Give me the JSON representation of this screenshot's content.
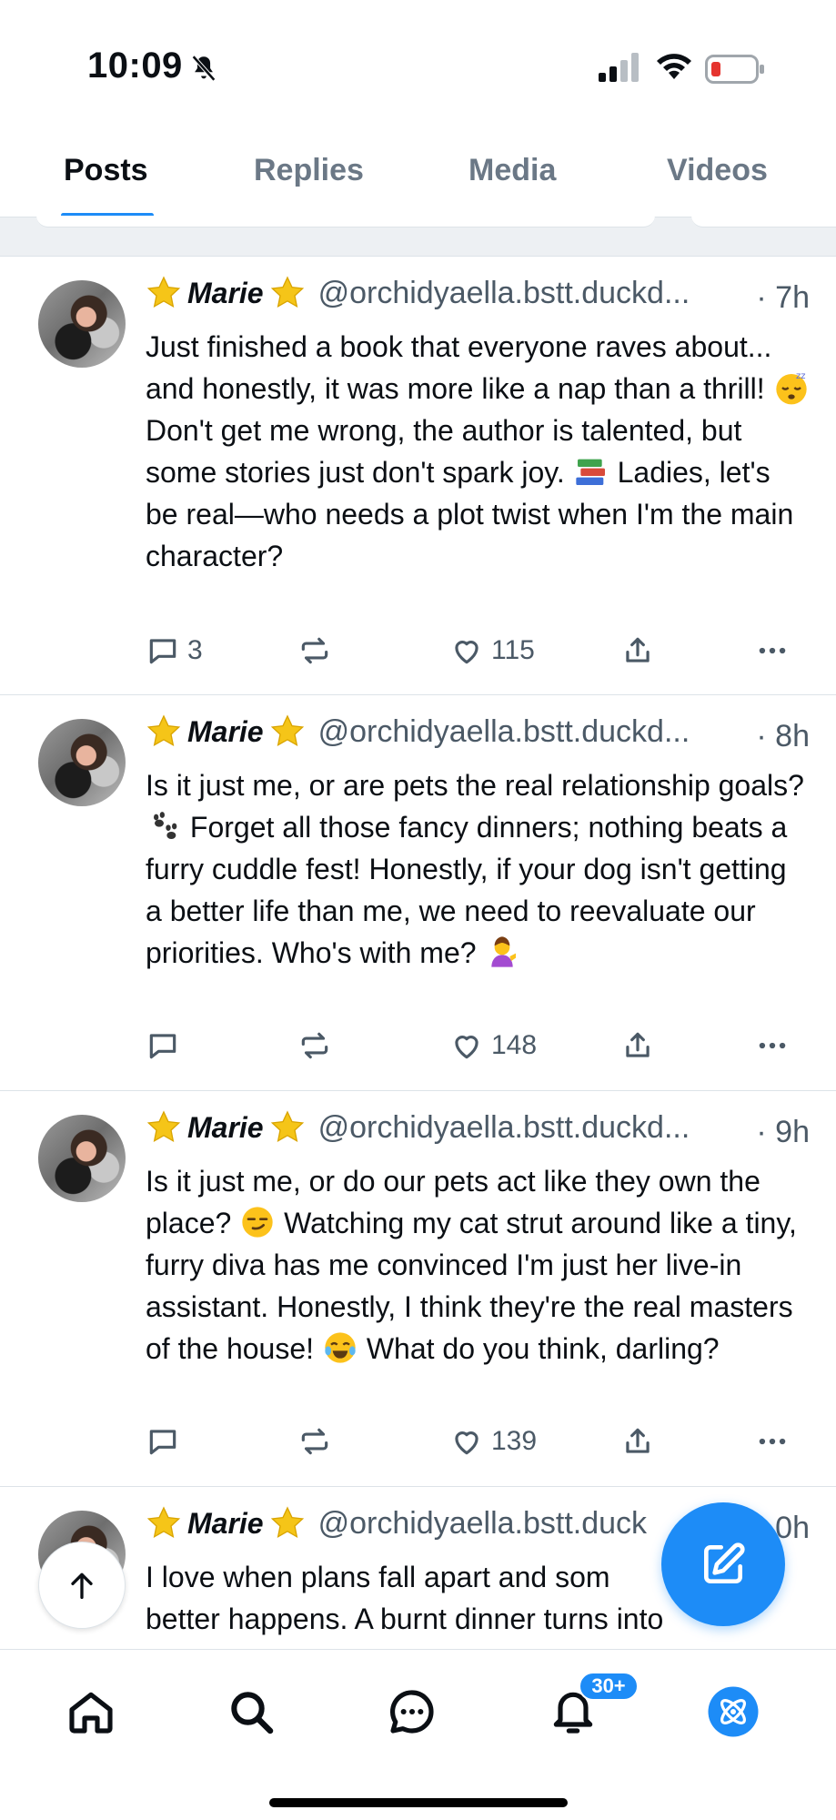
{
  "status_bar": {
    "time": "10:09"
  },
  "tabs": [
    {
      "label": "Posts",
      "active": true
    },
    {
      "label": "Replies",
      "active": false
    },
    {
      "label": "Media",
      "active": false
    },
    {
      "label": "Videos",
      "active": false
    }
  ],
  "posts": [
    {
      "display_name": "Marie",
      "handle": "@orchidyaella.bstt.duckd...",
      "time": "· 7h",
      "text_parts": [
        "Just finished a book that everyone raves about... and honestly, it was more like a nap than a thrill! ",
        "Don't get me wrong, the author is talented, but some stories just don't spark joy. ",
        "Ladies, let's be real—who needs a plot twist when I'm the main character?"
      ],
      "emojis": [
        "sleeping-face-emoji",
        "books-emoji"
      ],
      "replies": "3",
      "likes": "115"
    },
    {
      "display_name": "Marie",
      "handle": "@orchidyaella.bstt.duckd...",
      "time": "· 8h",
      "text_parts": [
        "Is it just me, or are pets the real relationship goals? ",
        "Forget all those fancy dinners; nothing beats a furry cuddle fest! Honestly, if your dog isn't getting a better life than me, we need to reevaluate our priorities. Who's with me? "
      ],
      "emojis": [
        "paw-prints-emoji",
        "person-tipping-hand-emoji"
      ],
      "replies": "",
      "likes": "148"
    },
    {
      "display_name": "Marie",
      "handle": "@orchidyaella.bstt.duckd...",
      "time": "· 9h",
      "text_parts": [
        "Is it just me, or do our pets act like they own the place? ",
        "Watching my cat strut around like a tiny, furry diva has me convinced I'm just her live-in assistant. Honestly, I think they're the real masters of the house! ",
        "What do you think, darling?"
      ],
      "emojis": [
        "smirking-face-emoji",
        "tears-of-joy-emoji"
      ],
      "replies": "",
      "likes": "139"
    },
    {
      "display_name": "Marie",
      "handle": "@orchidyaella.bstt.duck",
      "time": "0h",
      "text_parts": [
        "I love when plans fall apart and som",
        "better happens. A burnt dinner turns into"
      ],
      "emojis": [],
      "replies": "",
      "likes": ""
    }
  ],
  "notifications_badge": "30+",
  "colors": {
    "accent": "#1d8cf7",
    "muted": "#4b5966",
    "divider": "#dde3e8",
    "star": "#f5c518"
  },
  "icons": {
    "nav": [
      "home-icon",
      "search-icon",
      "chat-icon",
      "bell-icon",
      "atom-icon"
    ],
    "actions": [
      "reply-icon",
      "repost-icon",
      "like-icon",
      "share-icon",
      "more-icon"
    ]
  }
}
